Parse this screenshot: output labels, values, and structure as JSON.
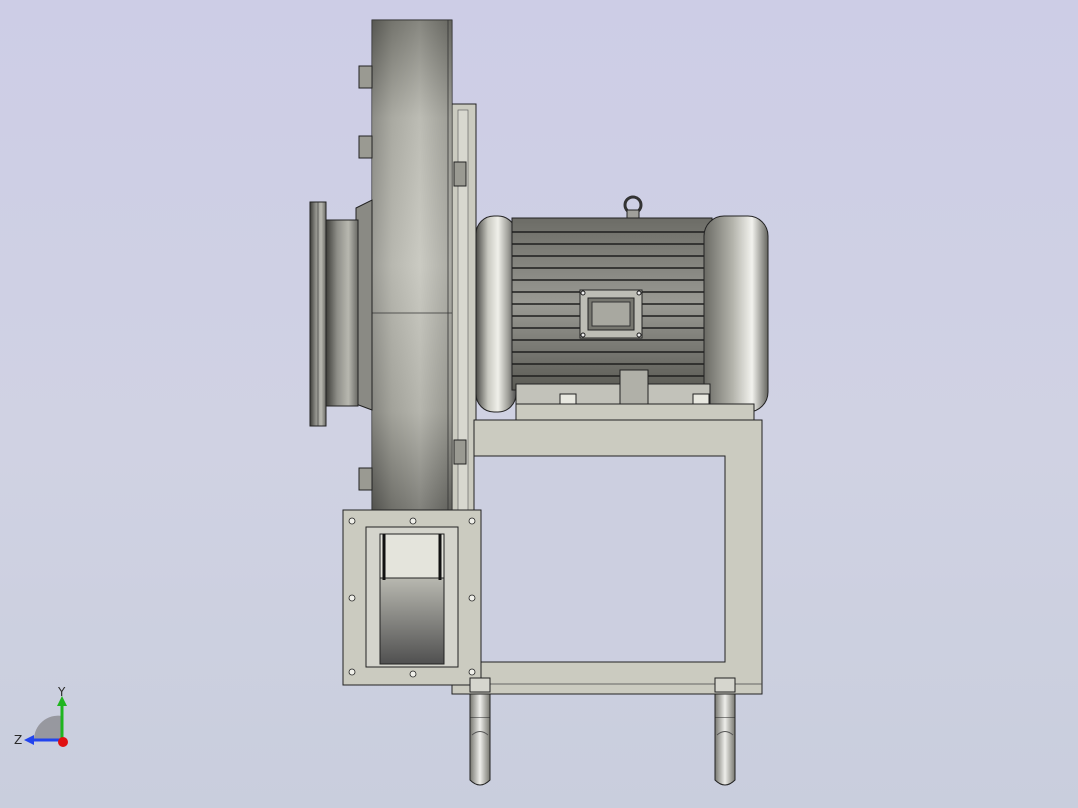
{
  "viewport": {
    "background_top": "#cdcde6",
    "background_bottom": "#c9cedd"
  },
  "model": {
    "description_icon": "centrifugal-blower-with-motor",
    "colors": {
      "steel_light": "#d8d8d0",
      "steel_mid": "#a6a69e",
      "steel_dark": "#4a4a46",
      "frame": "#cbcbc0",
      "edge": "#222222"
    }
  },
  "triad": {
    "y_label": "Y",
    "z_label": "Z",
    "y_color": "#1fb51f",
    "z_color": "#2244ee",
    "x_color": "#e01010"
  }
}
